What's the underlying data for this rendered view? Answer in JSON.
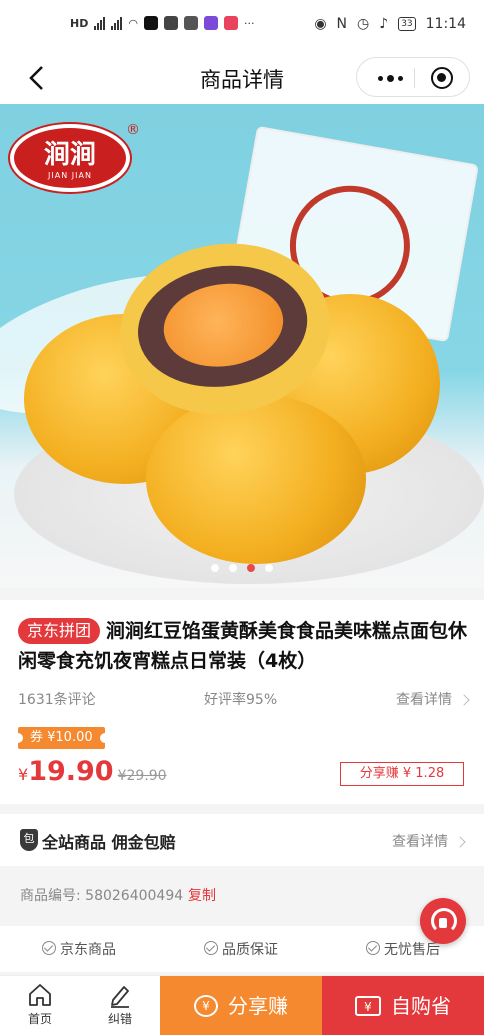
{
  "status_bar": {
    "left_label": "HD",
    "time": "11:14",
    "battery": "33"
  },
  "nav": {
    "title": "商品详情"
  },
  "hero": {
    "brand_cn": "涧涧",
    "brand_en": "JIAN JIAN",
    "registered": "®",
    "carousel_count": 4,
    "carousel_active": 3
  },
  "product": {
    "tag": "京东拼团",
    "title": "涧涧红豆馅蛋黄酥美食食品美味糕点面包休闲零食充饥夜宵糕点日常装（4枚）",
    "reviews": "1631条评论",
    "rating": "好评率95%",
    "details_link": "查看详情",
    "coupon": "券 ¥10.00",
    "currency": "¥",
    "price": "19.90",
    "original_price": "¥29.90",
    "share_earn": "分享赚 ¥ 1.28"
  },
  "guarantee": {
    "icon_text": "包",
    "text": "全站商品 佣金包赔",
    "details_link": "查看详情"
  },
  "sku": {
    "label": "商品编号: 58026400494",
    "copy": "复制"
  },
  "services": [
    "京东商品",
    "品质保证",
    "无忧售后"
  ],
  "bottom": {
    "home": "首页",
    "report": "纠错",
    "share": "分享赚",
    "buy": "自购省"
  },
  "colors": {
    "accent_red": "#e4393c",
    "accent_orange": "#f5892f"
  }
}
